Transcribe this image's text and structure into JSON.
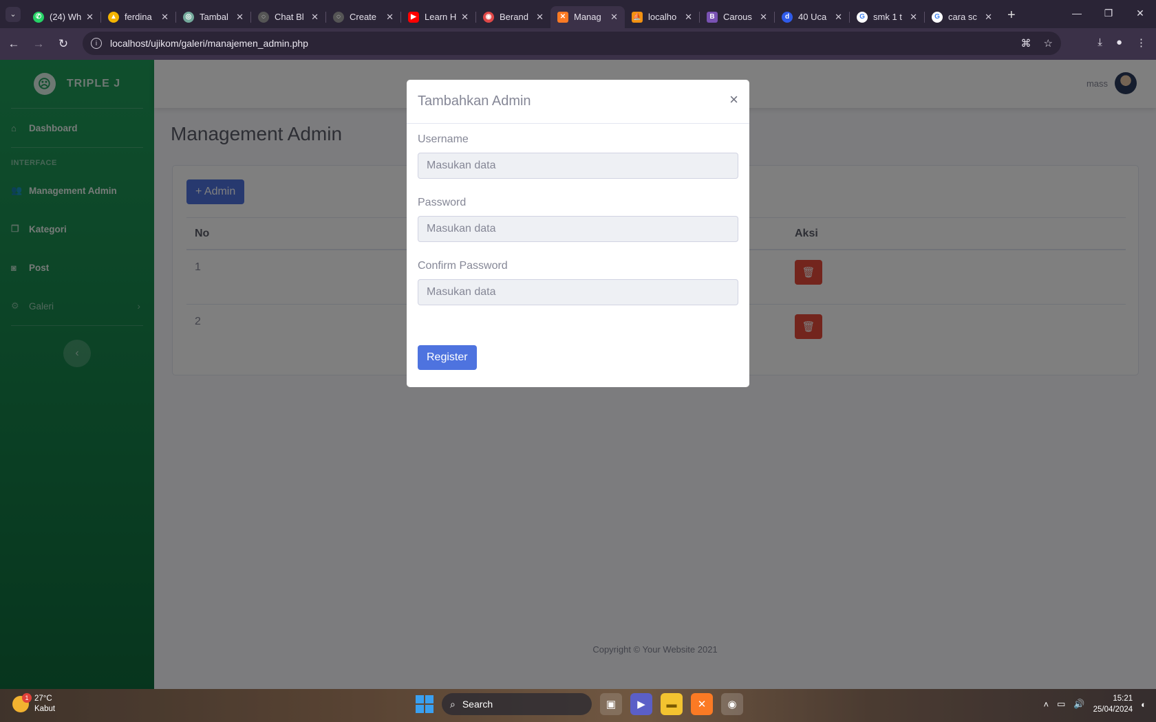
{
  "browser": {
    "tabs": [
      {
        "title": "(24) Wh",
        "fav_color": "#25d366",
        "fav_glyph": "✆"
      },
      {
        "title": "ferdina",
        "fav_color": "#f4b400",
        "fav_glyph": "▲"
      },
      {
        "title": "Tambal",
        "fav_color": "#74aa9c",
        "fav_glyph": "◎"
      },
      {
        "title": "Chat Bl",
        "fav_color": "#555555",
        "fav_glyph": "◌"
      },
      {
        "title": "Create",
        "fav_color": "#555555",
        "fav_glyph": "◌"
      },
      {
        "title": "Learn H",
        "fav_color": "#ff0000",
        "fav_glyph": "▶"
      },
      {
        "title": "Berand",
        "fav_color": "#e04848",
        "fav_glyph": "◉"
      },
      {
        "title": "Manag",
        "fav_color": "#fb7a24",
        "fav_glyph": "✕",
        "active": true
      },
      {
        "title": "localho",
        "fav_color": "#f29111",
        "fav_glyph": "⛵"
      },
      {
        "title": "Carous",
        "fav_color": "#7952b3",
        "fav_glyph": "B"
      },
      {
        "title": "40 Uca",
        "fav_color": "#2f5bea",
        "fav_glyph": "d"
      },
      {
        "title": "smk 1 t",
        "fav_color": "#4285f4",
        "fav_glyph": "G"
      },
      {
        "title": "cara sc",
        "fav_color": "#4285f4",
        "fav_glyph": "G"
      }
    ],
    "url": "localhost/ujikom/galeri/manajemen_admin.php"
  },
  "sidebar": {
    "brand": "TRIPLE J",
    "items": [
      {
        "label": "Dashboard",
        "icon": "home-icon"
      },
      {
        "label": "Management Admin",
        "icon": "users-icon"
      },
      {
        "label": "Kategori",
        "icon": "copy-icon"
      },
      {
        "label": "Post",
        "icon": "camera-icon"
      },
      {
        "label": "Galeri",
        "icon": "cog-icon"
      }
    ],
    "heading": "INTERFACE"
  },
  "topbar": {
    "username": "mass"
  },
  "main": {
    "title": "Management Admin",
    "add_button": "+ Admin",
    "table": {
      "headers": {
        "no": "No",
        "aksi": "Aksi"
      },
      "rows": [
        {
          "no": "1"
        },
        {
          "no": "2"
        }
      ]
    }
  },
  "modal": {
    "title": "Tambahkan Admin",
    "close": "×",
    "fields": [
      {
        "label": "Username",
        "placeholder": "Masukan data"
      },
      {
        "label": "Password",
        "placeholder": "Masukan data"
      },
      {
        "label": "Confirm Password",
        "placeholder": "Masukan data"
      }
    ],
    "submit": "Register"
  },
  "footer": "Copyright © Your Website 2021",
  "taskbar": {
    "temp": "27°C",
    "weather": "Kabut",
    "badge": "1",
    "search": "Search",
    "time": "15:21",
    "date": "25/04/2024"
  },
  "colors": {
    "sidebar": "#1f9d5a",
    "primary": "#4e73df",
    "danger": "#e74a3b"
  }
}
